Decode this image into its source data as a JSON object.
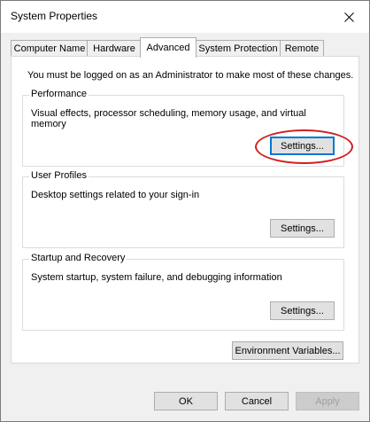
{
  "window": {
    "title": "System Properties"
  },
  "tabs": [
    {
      "label": "Computer Name"
    },
    {
      "label": "Hardware"
    },
    {
      "label": "Advanced",
      "active": true
    },
    {
      "label": "System Protection"
    },
    {
      "label": "Remote"
    }
  ],
  "advanced": {
    "admin_notice": "You must be logged on as an Administrator to make most of these changes.",
    "performance": {
      "title": "Performance",
      "description": "Visual effects, processor scheduling, memory usage, and virtual memory",
      "button": "Settings..."
    },
    "user_profiles": {
      "title": "User Profiles",
      "description": "Desktop settings related to your sign-in",
      "button": "Settings..."
    },
    "startup_recovery": {
      "title": "Startup and Recovery",
      "description": "System startup, system failure, and debugging information",
      "button": "Settings..."
    },
    "env_button": "Environment Variables..."
  },
  "dialog_buttons": {
    "ok": "OK",
    "cancel": "Cancel",
    "apply": "Apply"
  },
  "colors": {
    "highlight": "#d21f1f",
    "focus_border": "#0078d7"
  },
  "icons": {
    "close": "close-icon"
  }
}
